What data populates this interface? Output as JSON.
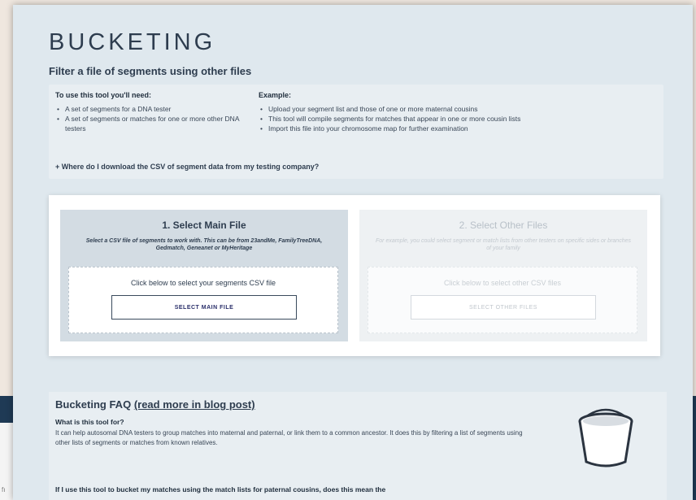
{
  "backdrop": {
    "text": "fı"
  },
  "page": {
    "title": "BUCKETING",
    "subtitle": "Filter a file of segments using other files"
  },
  "requirements": {
    "heading": "To use this tool you'll need:",
    "items": [
      "A set of segments for a DNA tester",
      "A set of segments or matches for one or more other DNA testers"
    ]
  },
  "example": {
    "heading": "Example:",
    "items": [
      "Upload your segment list and those of one or more maternal cousins",
      "This tool will compile segments for matches that appear in one or more cousin lists",
      "Import this file into your chromosome map for further examination"
    ]
  },
  "download_link": "+ Where do I download the CSV of segment data from my testing company?",
  "main_file": {
    "title": "1. Select Main File",
    "description": "Select a CSV file of segments to work with. This can be from 23andMe, FamilyTreeDNA, Gedmatch, Geneanet or MyHeritage",
    "prompt": "Click below to select your segments CSV file",
    "button": "SELECT MAIN FILE"
  },
  "other_files": {
    "title": "2. Select Other Files",
    "description": "For example, you could select segment or match lists from other testers on specific sides or branches of your family",
    "prompt": "Click below to select other CSV files",
    "button": "SELECT OTHER FILES"
  },
  "faq": {
    "heading": "Bucketing FAQ",
    "link": "(read more in blog post)",
    "q1": "What is this tool for?",
    "a1": "It can help autosomal DNA testers to group matches into maternal and paternal, or link them to a common ancestor. It does this by filtering a list of segments using other lists of segments or matches from known relatives.",
    "q2": "If I use this tool to bucket my matches using the match lists for paternal cousins, does this mean the",
    "icon": "bucket-icon"
  }
}
